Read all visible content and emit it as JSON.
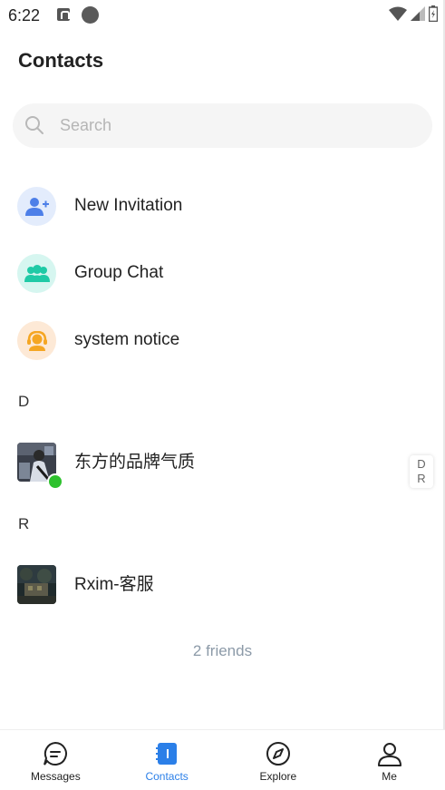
{
  "status_bar": {
    "time": "6:22"
  },
  "header": {
    "title": "Contacts"
  },
  "search": {
    "placeholder": "Search"
  },
  "special_items": [
    {
      "label": "New Invitation",
      "icon": "add-user-icon",
      "bg": "#e3ecfc",
      "fg": "#4d7fe8"
    },
    {
      "label": "Group Chat",
      "icon": "group-icon",
      "bg": "#d6f6f0",
      "fg": "#1fcaa6"
    },
    {
      "label": "system notice",
      "icon": "support-agent-icon",
      "bg": "#fde9d6",
      "fg": "#f5a623"
    }
  ],
  "sections": [
    {
      "letter": "D",
      "contacts": [
        {
          "name": "东方的品牌气质",
          "online": true
        }
      ]
    },
    {
      "letter": "R",
      "contacts": [
        {
          "name": "Rxim-客服",
          "online": false
        }
      ]
    }
  ],
  "index_bar": [
    "D",
    "R"
  ],
  "friends_count": "2 friends",
  "bottom_nav": [
    {
      "label": "Messages",
      "icon": "chat-bubble-icon",
      "active": false
    },
    {
      "label": "Contacts",
      "icon": "contacts-book-icon",
      "active": true
    },
    {
      "label": "Explore",
      "icon": "compass-icon",
      "active": false
    },
    {
      "label": "Me",
      "icon": "person-icon",
      "active": false
    }
  ],
  "colors": {
    "accent": "#2b7fe8",
    "online": "#2ec12e",
    "muted_text": "#8c9aa8"
  }
}
